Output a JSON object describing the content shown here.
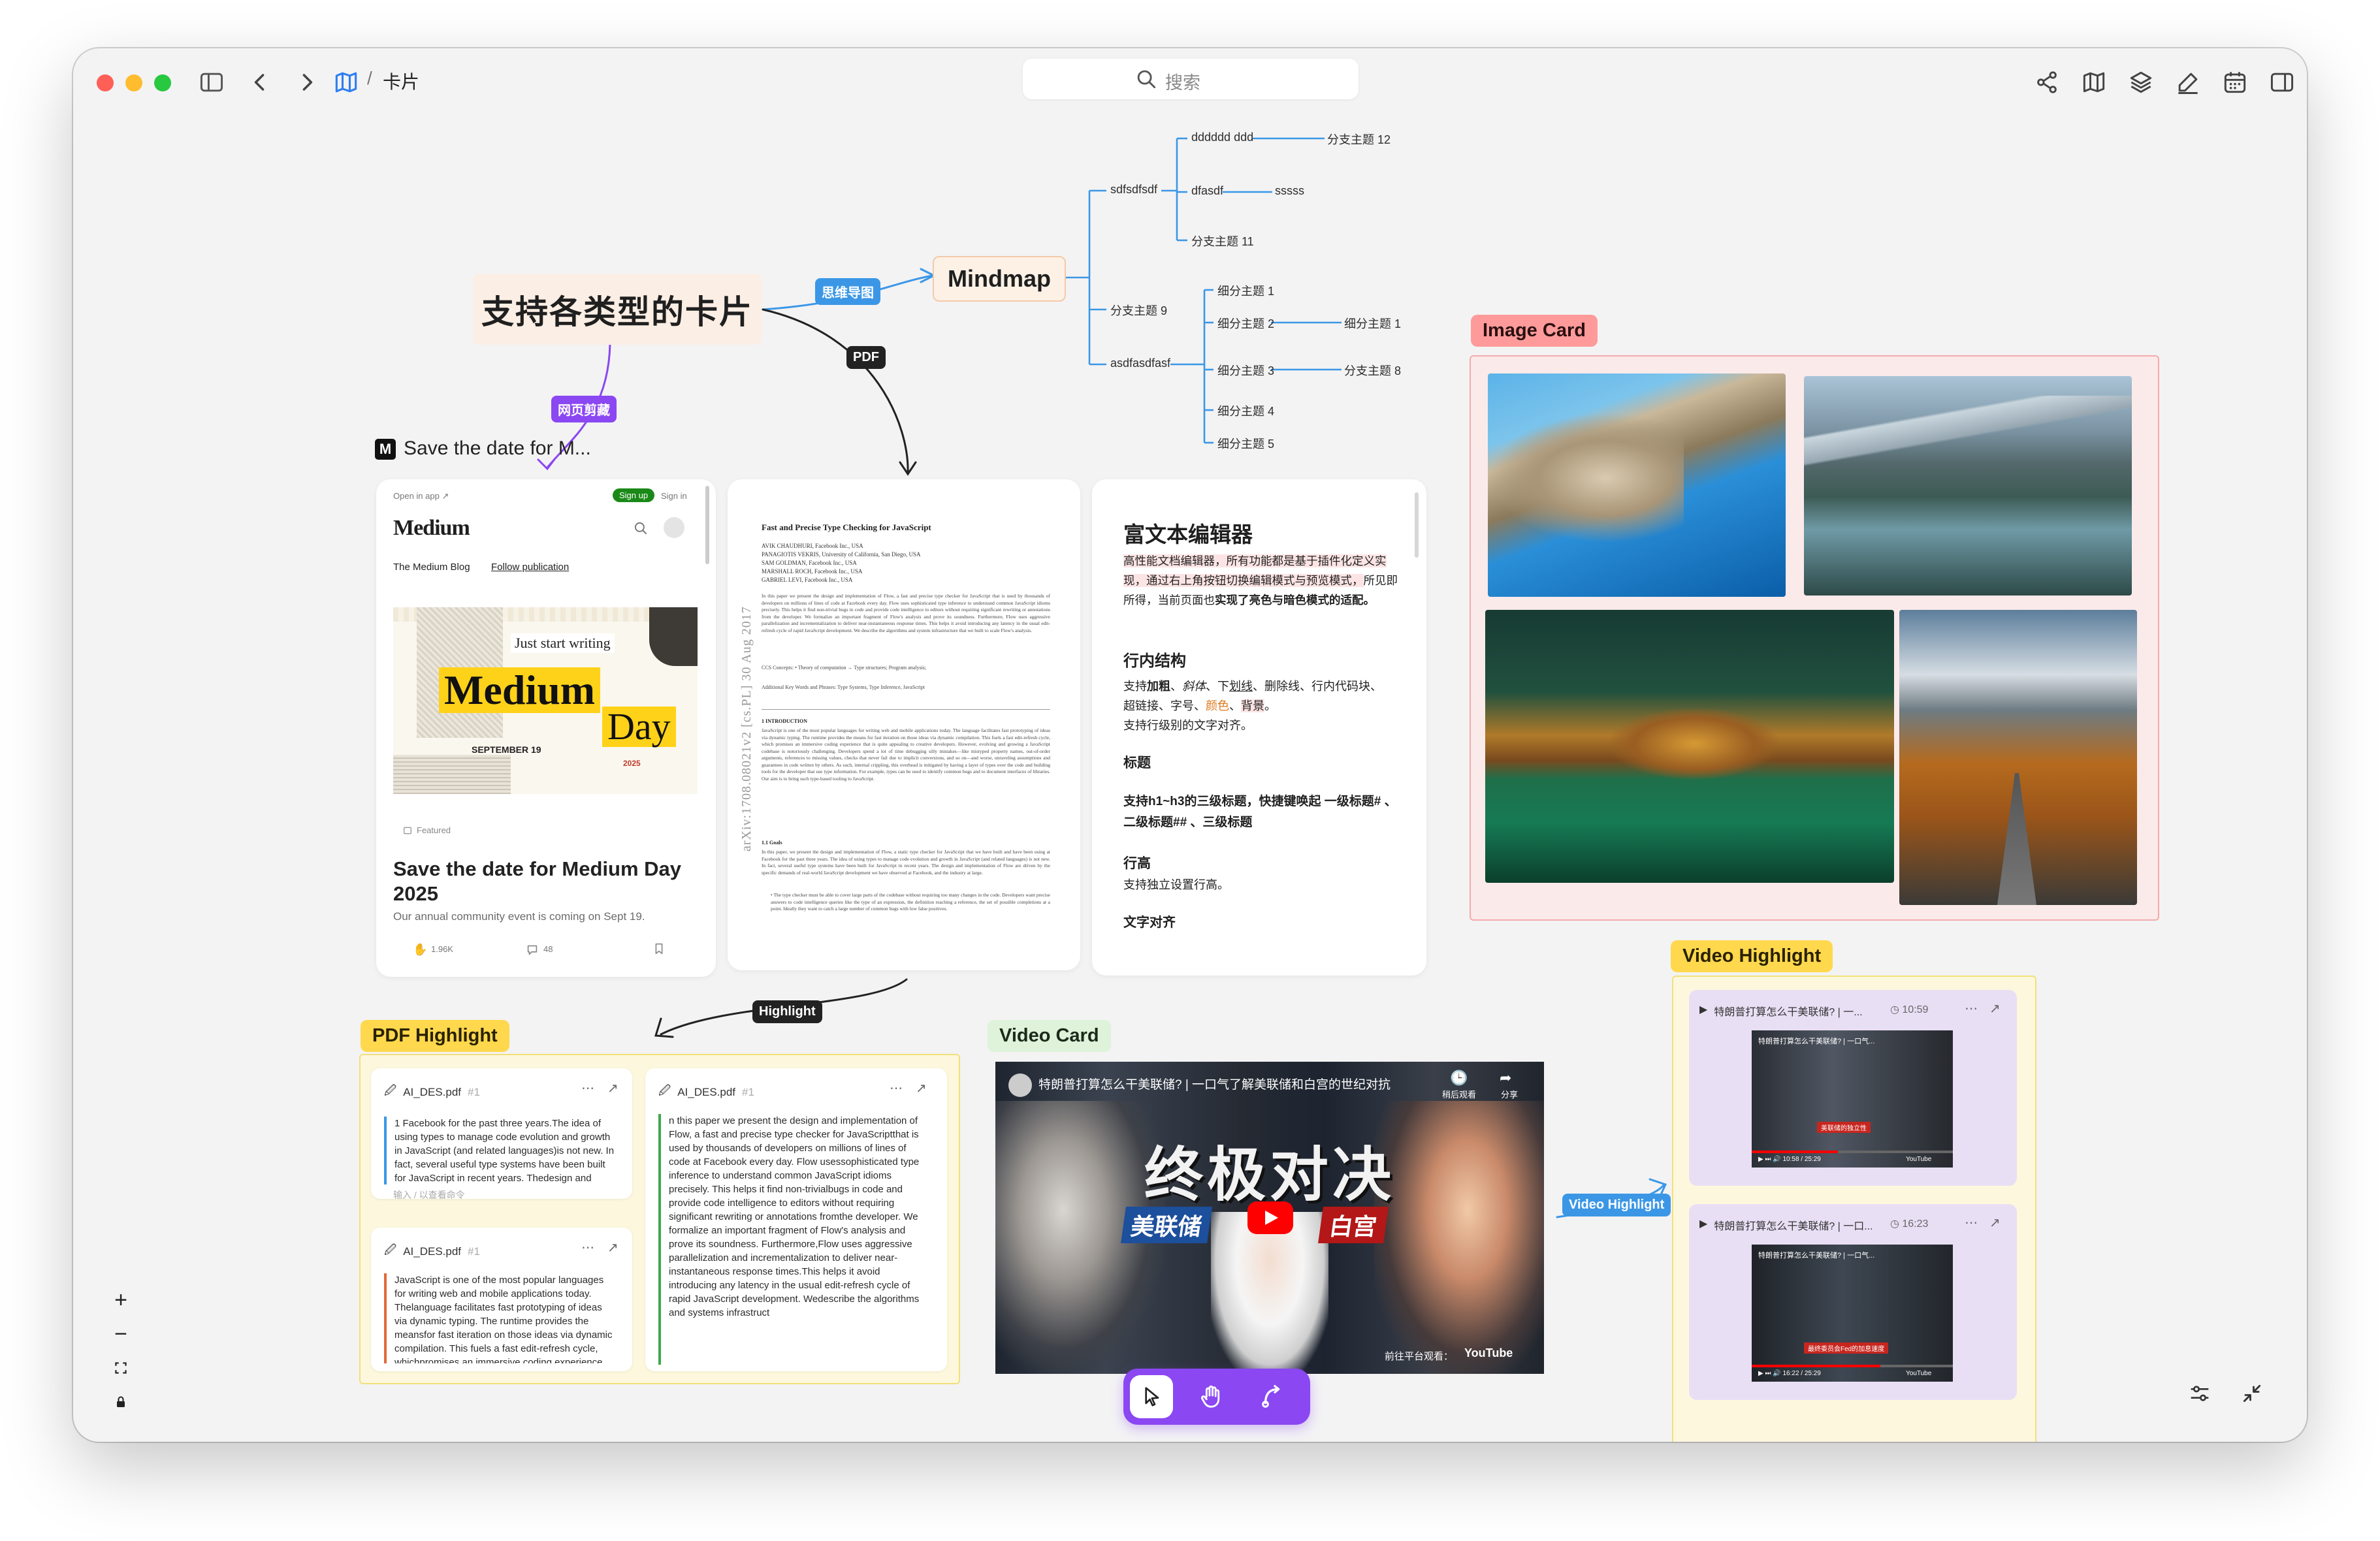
{
  "window": {
    "breadcrumb_sep": "/",
    "breadcrumb_current": "卡片"
  },
  "search": {
    "placeholder": "搜索"
  },
  "colors": {
    "accent": "#8b47f2",
    "mindmap_edge": "#3b97e6",
    "image_tag": "#ff9a9a",
    "pdf_tag": "#ffd84d",
    "video_card_tag": "#dff2da"
  },
  "canvas": {
    "title": "支持各类型的卡片",
    "edge_labels": {
      "web_clip": "网页剪藏",
      "mindmap": "思维导图",
      "pdf": "PDF",
      "highlight": "Highlight",
      "video_highlight": "Video Highlight"
    },
    "section_tags": {
      "image_card": "Image Card",
      "pdf_highlight": "PDF Highlight",
      "video_card": "Video Card",
      "video_highlight": "Video Highlight"
    }
  },
  "mindmap": {
    "root": "Mindmap",
    "nodes": {
      "a": "sdfsdfsdf",
      "a1": "dddddd ddd",
      "a1c": "分支主题 12",
      "a2": "dfasdf",
      "a2c": "sssss",
      "a3": "分支主题 11",
      "b": "分支主题 9",
      "c": "asdfasdfasf",
      "c1": "细分主题 1",
      "c2": "细分主题 2",
      "c2c": "细分主题 1",
      "c3": "细分主题 3",
      "c3c": "分支主题 8",
      "c4": "细分主题 4",
      "c5": "细分主题 5"
    }
  },
  "web_card": {
    "header_title": "Save the date for M...",
    "icon_letter": "M",
    "open_in_app": "Open in app ↗",
    "sign_up": "Sign up",
    "sign_in": "Sign in",
    "logo": "Medium",
    "blog_name": "The Medium Blog",
    "follow": "Follow publication",
    "hero": {
      "line1": "Just start writing",
      "big1": "Medium",
      "big2": "Day",
      "date": "SEPTEMBER 19",
      "year": "2025"
    },
    "featured": "Featured",
    "headline": "Save the date for Medium Day 2025",
    "summary": "Our annual community event is coming on Sept 19.",
    "claps": "1.96K",
    "comments": "48"
  },
  "pdf_card": {
    "title": "Fast and Precise Type Checking for JavaScript",
    "authors": [
      "AVIK CHAUDHURI, Facebook Inc., USA",
      "PANAGIOTIS VEKRIS, University of California, San Diego, USA",
      "SAM GOLDMAN, Facebook Inc., USA",
      "MARSHALL ROCH, Facebook Inc., USA",
      "GABRIEL LEVI, Facebook Inc., USA"
    ],
    "side_stamp": "arXiv:1708.08021v2 [cs.PL] 30 Aug 2017",
    "abstract": "In this paper we present the design and implementation of Flow, a fast and precise type checker for JavaScript that is used by thousands of developers on millions of lines of code at Facebook every day. Flow uses sophisticated type inference to understand common JavaScript idioms precisely. This helps it find non-trivial bugs in code and provide code intelligence to editors without requiring significant rewriting or annotations from the developer. We formalize an important fragment of Flow's analysis and prove its soundness. Furthermore, Flow uses aggressive parallelization and incrementalization to deliver near-instantaneous response times. This helps it avoid introducing any latency in the usual edit-refresh cycle of rapid JavaScript development. We describe the algorithms and system infrastructure that we built to scale Flow's analysis.",
    "ccs": "CCS Concepts: • Theory of computation → Type structures; Program analysis;",
    "keywords": "Additional Key Words and Phrases: Type Systems, Type Inference, JavaScript",
    "section1": "1   INTRODUCTION",
    "body1": "JavaScript is one of the most popular languages for writing web and mobile applications today. The language facilitates fast prototyping of ideas via dynamic typing. The runtime provides the means for fast iteration on those ideas via dynamic compilation. This fuels a fast edit-refresh cycle, which promises an immersive coding experience that is quite appealing to creative developers. However, evolving and growing a JavaScript codebase is notoriously challenging. Developers spend a lot of time debugging silly mistakes—like mistyped property names, out-of-order arguments, references to missing values, checks that never fail due to implicit conversions, and so on—and worse, unraveling assumptions and guarantees in code written by others. As such, internal crippling, this overhead is mitigated by having a layer of types over the code and building tools for the developer that use type information. For example, types can be used to identify common bugs and to document interfaces of libraries. Our aim is to bring such type-based tooling to JavaScript.",
    "section11": "1.1   Goals",
    "body2": "In this paper, we present the design and implementation of Flow, a static type checker for JavaScript that we have built and have been using at Facebook for the past three years. The idea of using types to manage code evolution and growth in JavaScript (and related languages) is not new. In fact, several useful type systems have been built for JavaScript in recent years. The design and implementation of Flow are driven by the specific demands of real-world JavaScript development we have observed at Facebook, and the industry at large.",
    "bullet": "• The type checker must be able to cover large parts of the codebase without requiring too many changes in the code. Developers want precise answers to code intelligence queries like the type of an expression, the definition reaching a reference, the set of possible completions at a point. Ideally they want to catch a large number of common bugs with low false positives."
  },
  "rich_text": {
    "title": "富文本编辑器",
    "intro_highlight": "高性能文档编辑器，所有功能都是基于插件化定义实现，通过右上角按钮切换编辑模式与预览模式，",
    "intro_plain": "所见即所得，当前页面也",
    "intro_bold": "实现了亮色与暗色模式的适配。",
    "h_inline": "行内结构",
    "inline_1a": "支持",
    "inline_bold": "加粗",
    "inline_1b": "、",
    "inline_italic": "斜体",
    "inline_1c": "、下",
    "inline_underline": "划线",
    "inline_1d": "、删除线、行内代码块、",
    "inline_2a": "超链接、字号、",
    "inline_color": "颜色",
    "inline_2b": "、",
    "inline_bg": "背景",
    "inline_2c": "。",
    "inline_3": "支持行级别的文字对齐。",
    "h_heading": "标题",
    "heading_desc": "支持h1~h3的三级标题，快捷键唤起 一级标题# 、二级标题## 、三级标题",
    "h_lineheight": "行高",
    "lineheight_desc": "支持独立设置行高。",
    "h_align": "文字对齐"
  },
  "pdf_highlights": [
    {
      "file": "AI_DES.pdf",
      "num": "#1",
      "text": "1 Facebook for the past three years.The idea of using types to manage code evolution and growth in JavaScript (and related languages)is not new. In fact, several useful type systems have been built for JavaScript in recent years. Thedesign and implementation of Flow are driven",
      "input_placeholder": "输入 / 以查看命令"
    },
    {
      "file": "AI_DES.pdf",
      "num": "#1",
      "text": "JavaScript is one of the most popular languages for writing web and mobile applications today. Thelanguage facilitates fast prototyping of ideas via dynamic typing. The runtime provides the meansfor fast iteration on those ideas via dynamic compilation. This fuels a fast edit-refresh cycle, whichpromises an immersive coding experience that is quite appealing to creative developers."
    },
    {
      "file": "AI_DES.pdf",
      "num": "#1",
      "text": "n this paper we present the design and implementation of Flow, a fast and precise type checker for JavaScriptthat is used by thousands of developers on millions of lines of code at Facebook every day. Flow usessophisticated type inference to understand common JavaScript idioms precisely. This helps it find non-trivialbugs in code and provide code intelligence to editors without requiring significant rewriting or annotations fromthe developer. We formalize an important fragment of Flow's analysis and prove its soundness. Furthermore,Flow uses aggressive parallelization and incrementalization to deliver near-instantaneous response times.This helps it avoid introducing any latency in the usual edit-refresh cycle of rapid JavaScript development. Wedescribe the algorithms and systems infrastruct"
    }
  ],
  "video_card": {
    "title": "特朗普打算怎么干美联储? | 一口气了解美联储和白宫的世纪对抗",
    "watch_later": "稍后观看",
    "share": "分享",
    "headline": "终极对决",
    "left_label": "美联储",
    "right_label": "白宫",
    "watch_on": "前往平台观看：",
    "youtube": "YouTube"
  },
  "video_highlights": [
    {
      "title": "特朗普打算怎么干美联储? | 一...",
      "time": "10:59",
      "thumb_title": "特朗普打算怎么干美联储? | 一口气...",
      "caption": "美联储的独立性",
      "progress": "10:58 / 25:29",
      "youtube": "YouTube"
    },
    {
      "title": "特朗普打算怎么干美联储? | 一口...",
      "time": "16:23",
      "thumb_title": "特朗普打算怎么干美联储? | 一口气...",
      "caption": "最终委员会Fed的加息速度",
      "progress": "16:22 / 25:29",
      "youtube": "YouTube"
    }
  ],
  "zoom": {
    "plus": "+",
    "minus": "−"
  }
}
